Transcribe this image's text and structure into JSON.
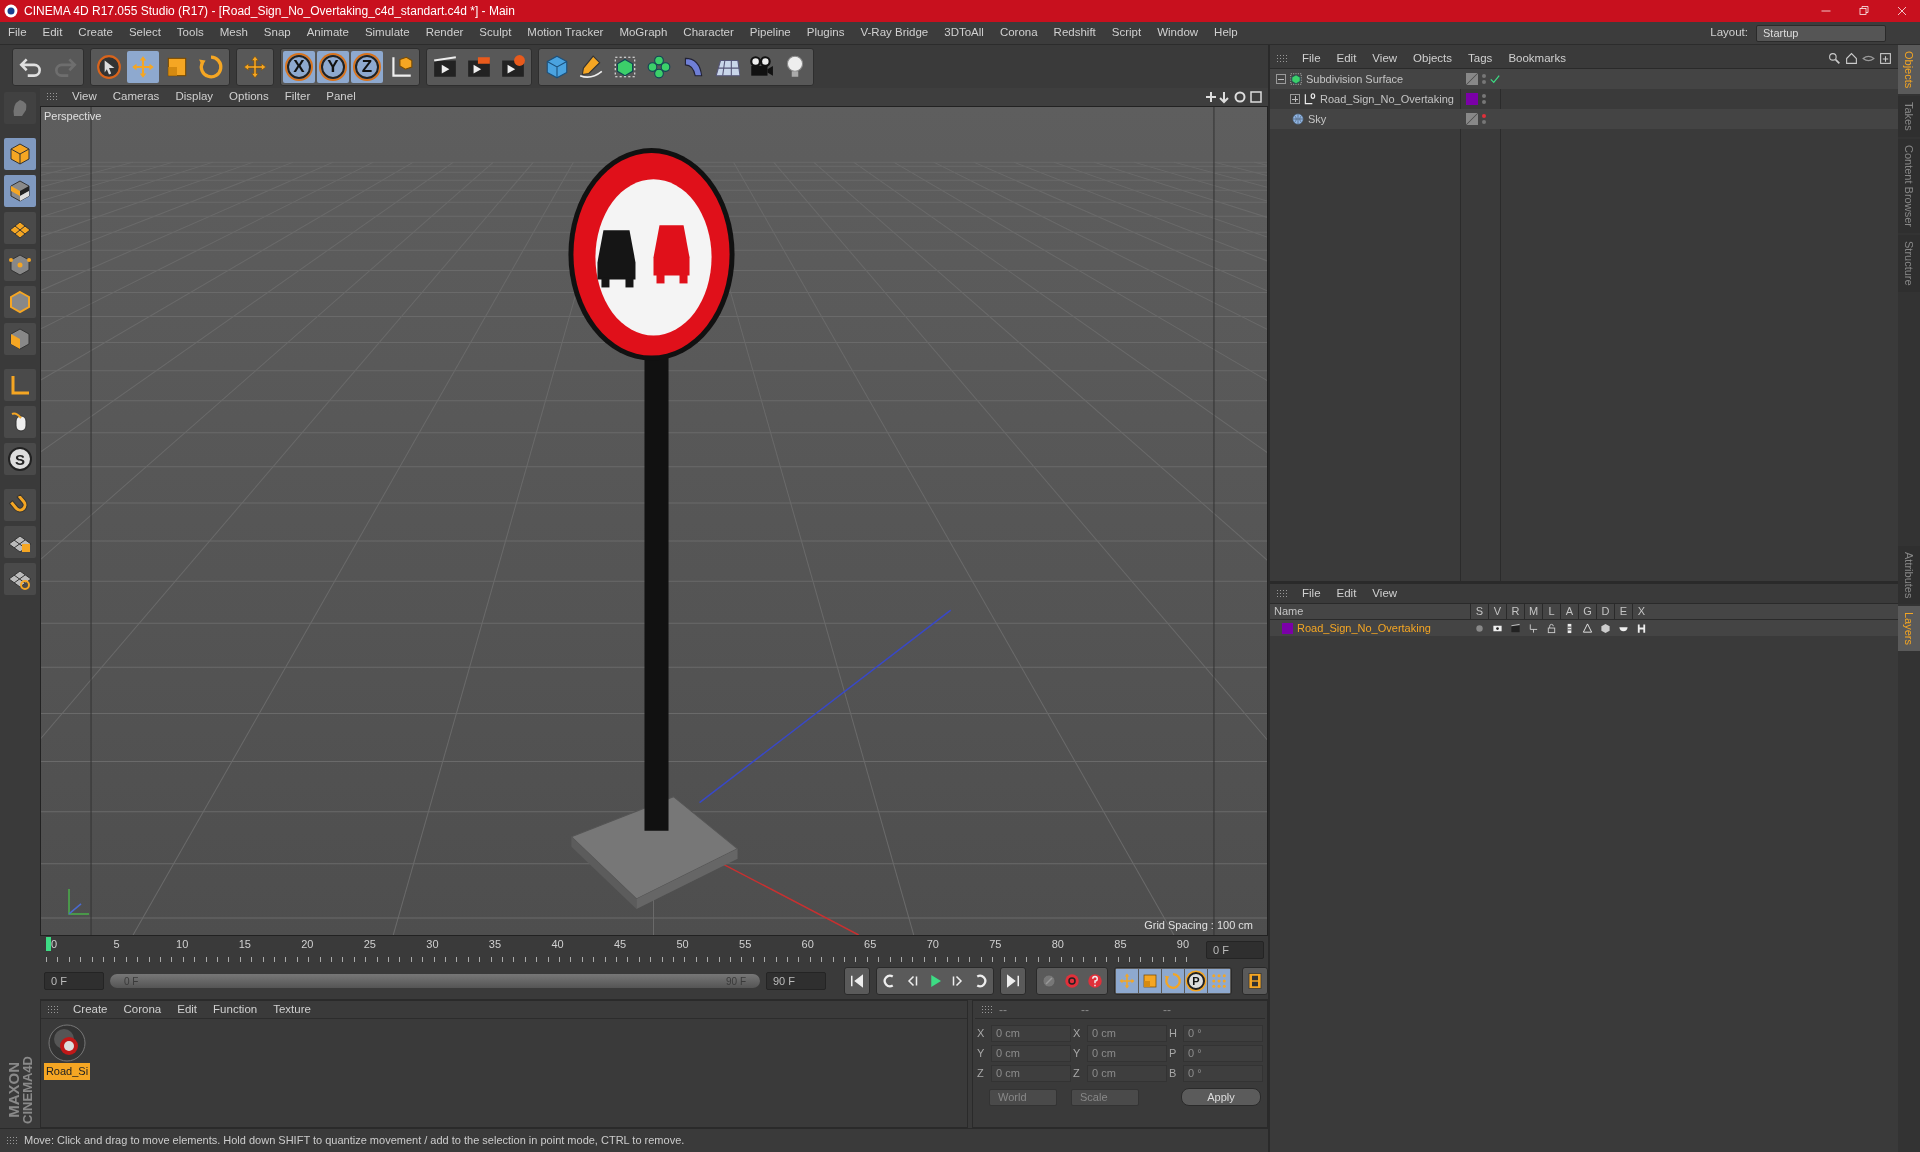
{
  "window": {
    "title": "CINEMA 4D R17.055 Studio (R17) - [Road_Sign_No_Overtaking_c4d_standart.c4d *] - Main"
  },
  "menu": [
    "File",
    "Edit",
    "Create",
    "Select",
    "Tools",
    "Mesh",
    "Snap",
    "Animate",
    "Simulate",
    "Render",
    "Sculpt",
    "Motion Tracker",
    "MoGraph",
    "Character",
    "Pipeline",
    "Plugins",
    "V-Ray Bridge",
    "3DToAll",
    "Corona",
    "Redshift",
    "Script",
    "Window",
    "Help"
  ],
  "layout": {
    "label": "Layout:",
    "value": "Startup"
  },
  "toolbar": [
    [
      {
        "kind": "undo",
        "selected": false,
        "disabled": false
      },
      {
        "kind": "redo",
        "selected": false,
        "disabled": true
      }
    ],
    [
      {
        "kind": "select",
        "selected": false,
        "disabled": false
      },
      {
        "kind": "move",
        "selected": true,
        "disabled": false
      },
      {
        "kind": "scale",
        "selected": false,
        "disabled": false
      },
      {
        "kind": "rotate",
        "selected": false,
        "disabled": false
      }
    ],
    [
      {
        "kind": "transform",
        "selected": false,
        "disabled": false
      }
    ],
    [
      {
        "kind": "axis",
        "label": "X",
        "selected": true,
        "disabled": false
      },
      {
        "kind": "axis",
        "label": "Y",
        "selected": true,
        "disabled": false
      },
      {
        "kind": "axis",
        "label": "Z",
        "selected": true,
        "disabled": false
      },
      {
        "kind": "coord",
        "selected": false,
        "disabled": false
      }
    ],
    [
      {
        "kind": "render-view",
        "selected": false,
        "disabled": false
      },
      {
        "kind": "render",
        "selected": false,
        "disabled": false
      },
      {
        "kind": "render-settings",
        "selected": false,
        "disabled": false
      }
    ],
    [
      {
        "kind": "cube",
        "selected": false,
        "disabled": false
      },
      {
        "kind": "pen",
        "selected": false,
        "disabled": false
      },
      {
        "kind": "subdivision",
        "selected": false,
        "disabled": false
      },
      {
        "kind": "cloner",
        "selected": false,
        "disabled": false
      },
      {
        "kind": "deformer",
        "selected": false,
        "disabled": false
      },
      {
        "kind": "floor",
        "selected": false,
        "disabled": false
      },
      {
        "kind": "camera",
        "selected": false,
        "disabled": false
      },
      {
        "kind": "light",
        "selected": false,
        "disabled": false
      }
    ]
  ],
  "left_tools": [
    {
      "kind": "sculpt",
      "selected": false,
      "disabled": true
    },
    {
      "kind": "model",
      "selected": true,
      "disabled": false
    },
    {
      "kind": "texture",
      "selected": true,
      "disabled": false
    },
    {
      "kind": "workplane",
      "selected": false,
      "disabled": false
    },
    {
      "kind": "points",
      "selected": false,
      "disabled": false
    },
    {
      "kind": "edges",
      "selected": false,
      "disabled": false
    },
    {
      "kind": "polygons",
      "selected": false,
      "disabled": false
    },
    {
      "kind": "axis-l",
      "selected": false,
      "disabled": false
    },
    {
      "kind": "tweak",
      "selected": false,
      "disabled": false
    },
    {
      "kind": "snap",
      "label": "S",
      "selected": false,
      "disabled": false
    },
    {
      "kind": "magnet",
      "selected": false,
      "disabled": false
    },
    {
      "kind": "grid-lock",
      "selected": false,
      "disabled": false
    },
    {
      "kind": "grid-rotate",
      "selected": false,
      "disabled": false
    }
  ],
  "logo": {
    "lines": [
      "MAXON",
      "CINEMA4D"
    ]
  },
  "viewport": {
    "menu": [
      "View",
      "Cameras",
      "Display",
      "Options",
      "Filter",
      "Panel"
    ],
    "camera": "Perspective",
    "grid_spacing": "Grid Spacing : 100 cm"
  },
  "timeline": {
    "ticks": [
      "0",
      "5",
      "10",
      "15",
      "20",
      "25",
      "30",
      "35",
      "40",
      "45",
      "50",
      "55",
      "60",
      "65",
      "70",
      "75",
      "80",
      "85",
      "90"
    ],
    "level": 0,
    "current": "0 F"
  },
  "playback": {
    "start": "0 F",
    "range_start": "0 F",
    "range_end": "90 F",
    "level": 1,
    "end": "90 F",
    "buttons": [
      [
        {
          "kind": "first"
        }
      ],
      [
        {
          "kind": "prev-key"
        },
        {
          "kind": "prev-frame"
        },
        {
          "kind": "play"
        },
        {
          "kind": "next-frame"
        },
        {
          "kind": "next-key"
        }
      ],
      [
        {
          "kind": "last"
        }
      ],
      [
        {
          "kind": "record-off"
        },
        {
          "kind": "record"
        },
        {
          "kind": "help"
        }
      ],
      [
        {
          "kind": "move"
        },
        {
          "kind": "scale"
        },
        {
          "kind": "rotate"
        },
        {
          "kind": "param",
          "label": "P"
        },
        {
          "kind": "dots"
        }
      ],
      [
        {
          "kind": "film"
        }
      ]
    ]
  },
  "materials": {
    "menu": [
      "Create",
      "Corona",
      "Edit",
      "Function",
      "Texture"
    ],
    "items": [
      {
        "name": "Road_Si",
        "selected": true
      }
    ]
  },
  "coordinates": {
    "columns": [
      {
        "header": "--",
        "fields": [
          {
            "label": "X",
            "value": "0 cm"
          },
          {
            "label": "Y",
            "value": "0 cm"
          },
          {
            "label": "Z",
            "value": "0 cm"
          }
        ],
        "mode": "World"
      },
      {
        "header": "--",
        "fields": [
          {
            "label": "X",
            "value": "0 cm"
          },
          {
            "label": "Y",
            "value": "0 cm"
          },
          {
            "label": "Z",
            "value": "0 cm"
          }
        ],
        "mode": "Scale"
      },
      {
        "header": "--",
        "fields": [
          {
            "label": "H",
            "value": "0 °"
          },
          {
            "label": "P",
            "value": "0 °"
          },
          {
            "label": "B",
            "value": "0 °"
          }
        ]
      }
    ],
    "apply": "Apply"
  },
  "status_bar": "Move: Click and drag to move elements. Hold down SHIFT to quantize movement / add to the selection in point mode, CTRL to remove.",
  "objects": {
    "menu": [
      "File",
      "Edit",
      "View",
      "Objects",
      "Tags",
      "Bookmarks"
    ],
    "tree": [
      {
        "name": "Subdivision Surface",
        "kind": "subdivision",
        "expanded": true,
        "checked": true,
        "render_off": false,
        "children": [
          {
            "name": "Road_Sign_No_Overtaking",
            "kind": "null",
            "expanded": false,
            "checked": false,
            "render_off": false,
            "color": "#7b00a8"
          }
        ]
      },
      {
        "name": "Sky",
        "kind": "sky",
        "checked": false,
        "render_off": true
      }
    ]
  },
  "layers": {
    "menu": [
      "File",
      "Edit",
      "View"
    ],
    "columns": [
      "Name",
      "S",
      "V",
      "R",
      "M",
      "L",
      "A",
      "G",
      "D",
      "E",
      "X"
    ],
    "rows": [
      {
        "name": "Road_Sign_No_Overtaking",
        "color": "#7b00a8",
        "selected": true
      }
    ]
  },
  "side_tabs": [
    {
      "label": "Objects",
      "selected": true
    },
    {
      "label": "Takes",
      "selected": false
    },
    {
      "label": "Content Browser",
      "selected": false
    },
    {
      "label": "Structure",
      "selected": false
    }
  ],
  "side_tabs_bottom": [
    {
      "label": "Attributes",
      "selected": false
    },
    {
      "label": "Layers",
      "selected": true
    }
  ]
}
